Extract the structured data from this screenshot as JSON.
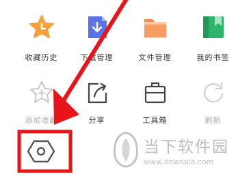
{
  "menu": {
    "items": [
      {
        "label": "收藏历史",
        "icon": "star-clock-icon"
      },
      {
        "label": "下载管理",
        "icon": "download-file-icon"
      },
      {
        "label": "文件管理",
        "icon": "folder-icon"
      },
      {
        "label": "我的书签",
        "icon": "book-bookmark-icon"
      },
      {
        "label": "添加收藏",
        "icon": "star-plus-icon"
      },
      {
        "label": "分享",
        "icon": "share-icon"
      },
      {
        "label": "工具箱",
        "icon": "toolbox-icon"
      },
      {
        "label": "刷新",
        "icon": "refresh-icon"
      }
    ]
  },
  "settings": {
    "icon": "hexagon-settings-icon"
  },
  "watermark": {
    "title": "当下软件园",
    "url": "www.downxia.com"
  },
  "colors": {
    "annotation_red": "#e8141a",
    "star_orange": "#f7a13a",
    "download_blue": "#5b73e8",
    "folder_orange": "#f58b4c",
    "book_green": "#2fb56b"
  }
}
